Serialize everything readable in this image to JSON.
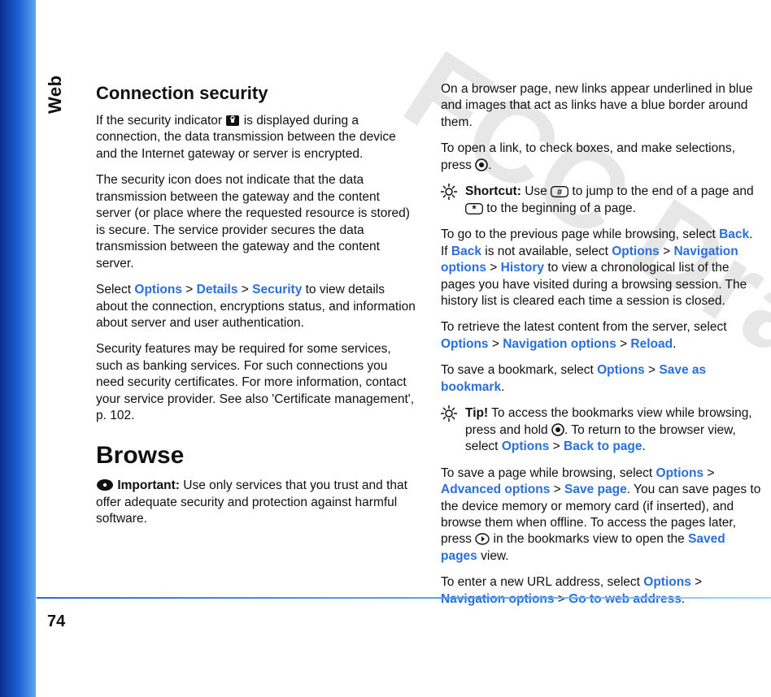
{
  "side_label": "Web",
  "page_number": "74",
  "watermark": "FCC Draft",
  "col1": {
    "h_connsec": "Connection security",
    "p1a": "If the security indicator ",
    "p1b": " is displayed during a connection, the data transmission between the device and the Internet gateway or server is encrypted.",
    "p2": "The security icon does not indicate that the data transmission between the gateway and the content server (or place where the requested resource is stored) is secure. The service provider secures the data transmission between the gateway and the content server.",
    "p3a": "Select ",
    "p3_options": "Options",
    "p3_gt1": " > ",
    "p3_details": "Details",
    "p3_gt2": " > ",
    "p3_security": "Security",
    "p3b": " to view details about the connection, encryptions status, and information about server and user authentication.",
    "p4": "Security features may be required for some services, such as banking services. For such connections you need security certificates. For more information, contact your service provider. See also 'Certificate management', p. 102.",
    "h_browse": "Browse",
    "imp_label": "Important:",
    "imp_body": " Use only services that you trust and that offer adequate security and protection against harmful software."
  },
  "col2": {
    "p1": "On a browser page, new links appear underlined in blue and images that act as links have a blue border around them.",
    "p2a": "To open a link, to check boxes, and make selections, press ",
    "p2b": ".",
    "sc_label": "Shortcut:",
    "sc_a": " Use ",
    "sc_b": " to jump to the end of a page and ",
    "sc_c": " to the beginning of a page.",
    "p3a": "To go to the previous page while browsing, select ",
    "p3_back": "Back",
    "p3b": ". If ",
    "p3_back2": "Back",
    "p3c": " is not available, select ",
    "p3_options": "Options",
    "p3_gt1": " > ",
    "p3_nav": "Navigation options",
    "p3_gt2": " > ",
    "p3_history": "History",
    "p3d": " to view a chronological list of the pages you have visited during a browsing session. The history list is cleared each time a session is closed.",
    "p4a": "To retrieve the latest content from the server, select ",
    "p4_options": "Options",
    "p4_gt1": " > ",
    "p4_nav": "Navigation options",
    "p4_gt2": " > ",
    "p4_reload": "Reload",
    "p4b": ".",
    "p5a": "To save a bookmark, select ",
    "p5_options": "Options",
    "p5_gt": " > ",
    "p5_save": "Save as bookmark",
    "p5b": ".",
    "tip_label": "Tip!",
    "tip_a": " To access the bookmarks view while browsing, press and hold ",
    "tip_b": ". To return to the browser view, select ",
    "tip_options": "Options",
    "tip_gt": " > ",
    "tip_back": "Back to page",
    "tip_c": ".",
    "p6a": "To save a page while browsing, select ",
    "p6_options": "Options",
    "p6_gt1": " > ",
    "p6_adv": "Advanced options",
    "p6_gt2": " > ",
    "p6_savepage": "Save page",
    "p6b": ". You can save pages to the device memory or memory card (if inserted), and browse them when offline. To access the pages later, press ",
    "p6c": " in the bookmarks view to open the ",
    "p6_saved": "Saved pages",
    "p6d": " view.",
    "p7a": "To enter a new URL address, select ",
    "p7_options": "Options",
    "p7_gt1": " > ",
    "p7_nav": "Navigation options",
    "p7_gt2": " > ",
    "p7_go": "Go to web address",
    "p7b": "."
  }
}
